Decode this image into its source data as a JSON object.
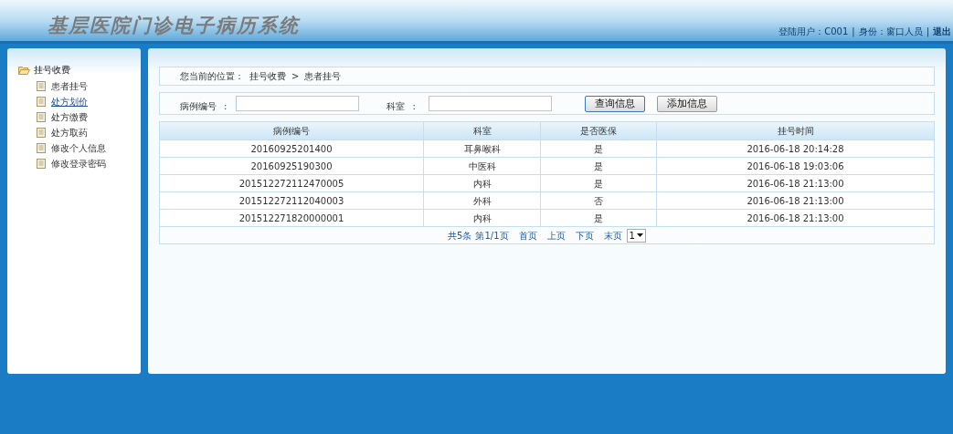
{
  "header": {
    "title": "基层医院门诊电子病历系统",
    "user_label": "登陆用户：C001",
    "role_label": "身份：窗口人员",
    "logout": "退出",
    "separator": "|"
  },
  "sidebar": {
    "group": {
      "label": "挂号收费",
      "expanded": true,
      "children": [
        {
          "label": "患者挂号",
          "selected": false
        },
        {
          "label": "处方划价",
          "selected": true
        },
        {
          "label": "处方缴费",
          "selected": false
        },
        {
          "label": "处方取药",
          "selected": false
        },
        {
          "label": "修改个人信息",
          "selected": false
        },
        {
          "label": "修改登录密码",
          "selected": false
        }
      ]
    }
  },
  "breadcrumb": {
    "prefix": "您当前的位置：",
    "items": [
      "挂号收费",
      "患者挂号"
    ],
    "separator": ">"
  },
  "search": {
    "fields": [
      {
        "label": "病例编号",
        "colon": ":"
      },
      {
        "label": "科室",
        "colon": ":"
      }
    ],
    "buttons": [
      {
        "label": "查询信息",
        "focused": true
      },
      {
        "label": "添加信息",
        "focused": false
      }
    ]
  },
  "table": {
    "columns": [
      "病例编号",
      "科室",
      "是否医保",
      "挂号时间"
    ],
    "rows": [
      [
        "20160925201400",
        "耳鼻喉科",
        "是",
        "2016-06-18 20:14:28"
      ],
      [
        "20160925190300",
        "中医科",
        "是",
        "2016-06-18 19:03:06"
      ],
      [
        "201512272112470005",
        "内科",
        "是",
        "2016-06-18 21:13:00"
      ],
      [
        "201512272112040003",
        "外科",
        "否",
        "2016-06-18 21:13:00"
      ],
      [
        "201512271820000001",
        "内科",
        "是",
        "2016-06-18 21:13:00"
      ]
    ]
  },
  "pagination": {
    "total": "共5条",
    "page": "第1/1页",
    "links": [
      "首页",
      "上页",
      "下页",
      "末页"
    ],
    "page_select": "1"
  }
}
